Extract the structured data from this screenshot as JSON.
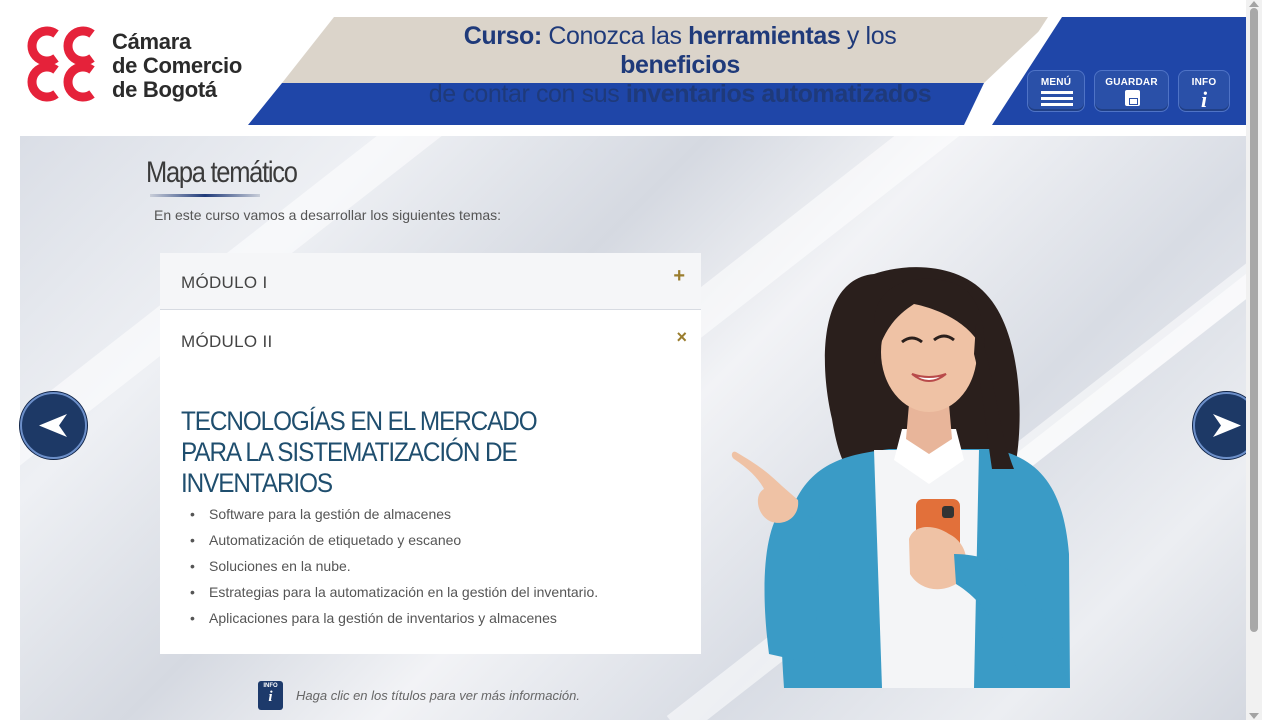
{
  "brand": {
    "lines": [
      "Cámara",
      "de Comercio",
      "de Bogotá"
    ],
    "red": "#e5223a"
  },
  "banner": {
    "line1_prefix": "Curso:",
    "line1_a": " Conozca las ",
    "line1_b": "herramientas",
    "line1_c": " y los ",
    "line1_d": "beneficios",
    "line2_a": "de contar con sus ",
    "line2_b": "inventarios automatizados",
    "navy": "#1f3a7a",
    "beige": "#dbd4ca",
    "blue": "#1f46a8"
  },
  "toolbar": {
    "menu_label": "MENÚ",
    "save_label": "GUARDAR",
    "info_label": "INFO",
    "info_glyph": "i"
  },
  "main": {
    "title": "Mapa temático",
    "intro": "En este curso vamos a desarrollar los siguientes temas:",
    "modules": [
      {
        "label": "MÓDULO I",
        "toggle": "+",
        "expanded": false
      },
      {
        "label": "MÓDULO II",
        "toggle": "×",
        "expanded": true
      }
    ],
    "section_title": "TECNOLOGÍAS EN EL MERCADO PARA LA SISTEMATIZACIÓN DE INVENTARIOS",
    "topics": [
      "Software para la gestión de almacenes",
      "Automatización de etiquetado y escaneo",
      "Soluciones en la nube.",
      "Estrategias para la automatización en la gestión del inventario.",
      "Aplicaciones para la gestión de inventarios y almacenes"
    ],
    "hint_icon_label": "INFO",
    "hint_icon_glyph": "i",
    "hint": "Haga clic en los títulos para ver más información."
  },
  "icons": {
    "prev": "arrow-left-icon",
    "next": "arrow-right-icon",
    "menu": "hamburger-icon",
    "save": "floppy-disk-icon",
    "info": "info-icon"
  }
}
